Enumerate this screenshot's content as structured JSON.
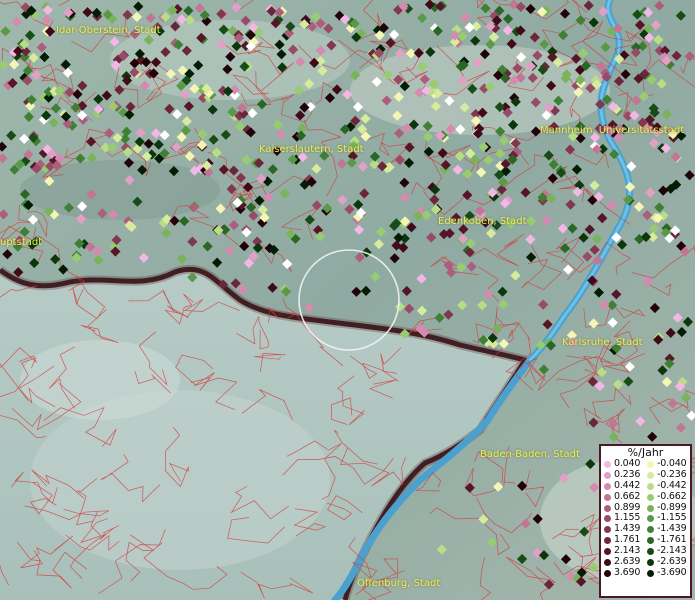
{
  "map": {
    "cities": [
      {
        "name": "Idar-Oberstein, Stadt"
      },
      {
        "name": "Mannheim, Universitätsstadt"
      },
      {
        "name": "Kaiserslautern, Stadt"
      },
      {
        "name": "Edenkoben, Stadt"
      },
      {
        "name": "uptstadt"
      },
      {
        "name": "Karlsruhe, Stadt"
      },
      {
        "name": "Baden-Baden, Stadt"
      },
      {
        "name": "Offenburg, Stadt"
      }
    ]
  },
  "legend": {
    "title": "%/Jahr",
    "positive": [
      {
        "value": "0.040",
        "color": "#f4b6e4"
      },
      {
        "value": "0.236",
        "color": "#e49fc6"
      },
      {
        "value": "0.442",
        "color": "#d68aaf"
      },
      {
        "value": "0.662",
        "color": "#c27595"
      },
      {
        "value": "0.899",
        "color": "#ad5e7c"
      },
      {
        "value": "1.155",
        "color": "#984b66"
      },
      {
        "value": "1.439",
        "color": "#823750"
      },
      {
        "value": "1.761",
        "color": "#6c263b"
      },
      {
        "value": "2.143",
        "color": "#561628"
      },
      {
        "value": "2.639",
        "color": "#400a19"
      },
      {
        "value": "3.690",
        "color": "#22020a"
      }
    ],
    "negative": [
      {
        "value": "-0.040",
        "color": "#f4f6b4"
      },
      {
        "value": "-0.236",
        "color": "#d6ec9c"
      },
      {
        "value": "-0.442",
        "color": "#b8de84"
      },
      {
        "value": "-0.662",
        "color": "#98cc70"
      },
      {
        "value": "-0.899",
        "color": "#78b45a"
      },
      {
        "value": "-1.155",
        "color": "#5a9a46"
      },
      {
        "value": "-1.439",
        "color": "#3f8034"
      },
      {
        "value": "-1.761",
        "color": "#2a6624"
      },
      {
        "value": "-2.143",
        "color": "#184c16"
      },
      {
        "value": "-2.639",
        "color": "#0c360c"
      },
      {
        "value": "-3.690",
        "color": "#031c04"
      }
    ]
  }
}
